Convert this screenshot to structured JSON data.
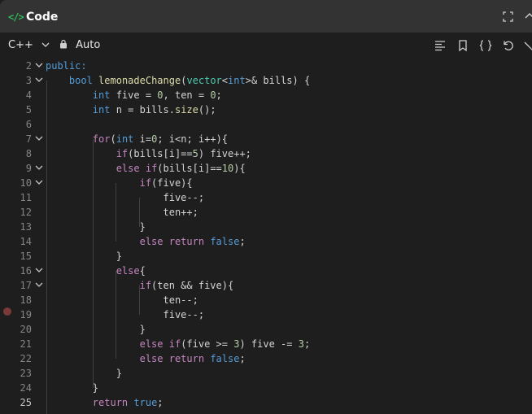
{
  "header": {
    "title": "Code",
    "code_icon_glyph": "</>",
    "code_icon": "code-icon",
    "accent": "#2cbb5d"
  },
  "toolbar": {
    "language": "C++",
    "mode": "Auto",
    "icons": [
      "format-icon",
      "bookmark-icon",
      "braces-icon",
      "reset-icon",
      "more-icon"
    ]
  },
  "editor": {
    "active_line": "25",
    "breakpoint_line": "15",
    "lines": [
      {
        "n": "2",
        "fold": true,
        "tokens": [
          {
            "t": "public:",
            "c": "kw"
          }
        ]
      },
      {
        "n": "3",
        "fold": true,
        "tokens": [
          {
            "t": "    "
          },
          {
            "t": "bool",
            "c": "kw"
          },
          {
            "t": " "
          },
          {
            "t": "lemonadeChange",
            "c": "fn"
          },
          {
            "t": "("
          },
          {
            "t": "vector",
            "c": "ty"
          },
          {
            "t": "<"
          },
          {
            "t": "int",
            "c": "kw"
          },
          {
            "t": ">& "
          },
          {
            "t": "bills"
          },
          {
            "t": ") {"
          }
        ]
      },
      {
        "n": "4",
        "fold": false,
        "tokens": [
          {
            "t": "        "
          },
          {
            "t": "int",
            "c": "kw"
          },
          {
            "t": " five = "
          },
          {
            "t": "0",
            "c": "nm"
          },
          {
            "t": ", ten = "
          },
          {
            "t": "0",
            "c": "nm"
          },
          {
            "t": ";"
          }
        ]
      },
      {
        "n": "5",
        "fold": false,
        "tokens": [
          {
            "t": "        "
          },
          {
            "t": "int",
            "c": "kw"
          },
          {
            "t": " n = bills."
          },
          {
            "t": "size",
            "c": "fn"
          },
          {
            "t": "();"
          }
        ]
      },
      {
        "n": "6",
        "fold": false,
        "tokens": [
          {
            "t": ""
          }
        ]
      },
      {
        "n": "7",
        "fold": true,
        "tokens": [
          {
            "t": "        "
          },
          {
            "t": "for",
            "c": "kc"
          },
          {
            "t": "("
          },
          {
            "t": "int",
            "c": "kw"
          },
          {
            "t": " i="
          },
          {
            "t": "0",
            "c": "nm"
          },
          {
            "t": "; i<n; i++){"
          }
        ]
      },
      {
        "n": "8",
        "fold": false,
        "tokens": [
          {
            "t": "            "
          },
          {
            "t": "if",
            "c": "kc"
          },
          {
            "t": "(bills[i]=="
          },
          {
            "t": "5",
            "c": "nm"
          },
          {
            "t": ") five++;"
          }
        ]
      },
      {
        "n": "9",
        "fold": true,
        "tokens": [
          {
            "t": "            "
          },
          {
            "t": "else",
            "c": "kc"
          },
          {
            "t": " "
          },
          {
            "t": "if",
            "c": "kc"
          },
          {
            "t": "(bills[i]=="
          },
          {
            "t": "10",
            "c": "nm"
          },
          {
            "t": "){"
          }
        ]
      },
      {
        "n": "10",
        "fold": true,
        "tokens": [
          {
            "t": "                "
          },
          {
            "t": "if",
            "c": "kc"
          },
          {
            "t": "(five){"
          }
        ]
      },
      {
        "n": "11",
        "fold": false,
        "tokens": [
          {
            "t": "                    five--;"
          }
        ]
      },
      {
        "n": "12",
        "fold": false,
        "tokens": [
          {
            "t": "                    ten++;"
          }
        ]
      },
      {
        "n": "13",
        "fold": false,
        "tokens": [
          {
            "t": "                }"
          }
        ]
      },
      {
        "n": "14",
        "fold": false,
        "tokens": [
          {
            "t": "                "
          },
          {
            "t": "else",
            "c": "kc"
          },
          {
            "t": " "
          },
          {
            "t": "return",
            "c": "kc"
          },
          {
            "t": " "
          },
          {
            "t": "false",
            "c": "kw"
          },
          {
            "t": ";"
          }
        ]
      },
      {
        "n": "15",
        "fold": false,
        "tokens": [
          {
            "t": "            }"
          }
        ]
      },
      {
        "n": "16",
        "fold": true,
        "tokens": [
          {
            "t": "            "
          },
          {
            "t": "else",
            "c": "kc"
          },
          {
            "t": "{"
          }
        ]
      },
      {
        "n": "17",
        "fold": true,
        "tokens": [
          {
            "t": "                "
          },
          {
            "t": "if",
            "c": "kc"
          },
          {
            "t": "(ten && five){"
          }
        ]
      },
      {
        "n": "18",
        "fold": false,
        "tokens": [
          {
            "t": "                    ten--;"
          }
        ]
      },
      {
        "n": "19",
        "fold": false,
        "tokens": [
          {
            "t": "                    five--;"
          }
        ]
      },
      {
        "n": "20",
        "fold": false,
        "tokens": [
          {
            "t": "                }"
          }
        ]
      },
      {
        "n": "21",
        "fold": false,
        "tokens": [
          {
            "t": "                "
          },
          {
            "t": "else",
            "c": "kc"
          },
          {
            "t": " "
          },
          {
            "t": "if",
            "c": "kc"
          },
          {
            "t": "(five >= "
          },
          {
            "t": "3",
            "c": "nm"
          },
          {
            "t": ") five -= "
          },
          {
            "t": "3",
            "c": "nm"
          },
          {
            "t": ";"
          }
        ]
      },
      {
        "n": "22",
        "fold": false,
        "tokens": [
          {
            "t": "                "
          },
          {
            "t": "else",
            "c": "kc"
          },
          {
            "t": " "
          },
          {
            "t": "return",
            "c": "kc"
          },
          {
            "t": " "
          },
          {
            "t": "false",
            "c": "kw"
          },
          {
            "t": ";"
          }
        ]
      },
      {
        "n": "23",
        "fold": false,
        "tokens": [
          {
            "t": "            }"
          }
        ]
      },
      {
        "n": "24",
        "fold": false,
        "tokens": [
          {
            "t": "        }"
          }
        ]
      },
      {
        "n": "25",
        "fold": false,
        "tokens": [
          {
            "t": "        "
          },
          {
            "t": "return",
            "c": "kc"
          },
          {
            "t": " "
          },
          {
            "t": "true",
            "c": "kw"
          },
          {
            "t": ";"
          }
        ]
      }
    ]
  }
}
